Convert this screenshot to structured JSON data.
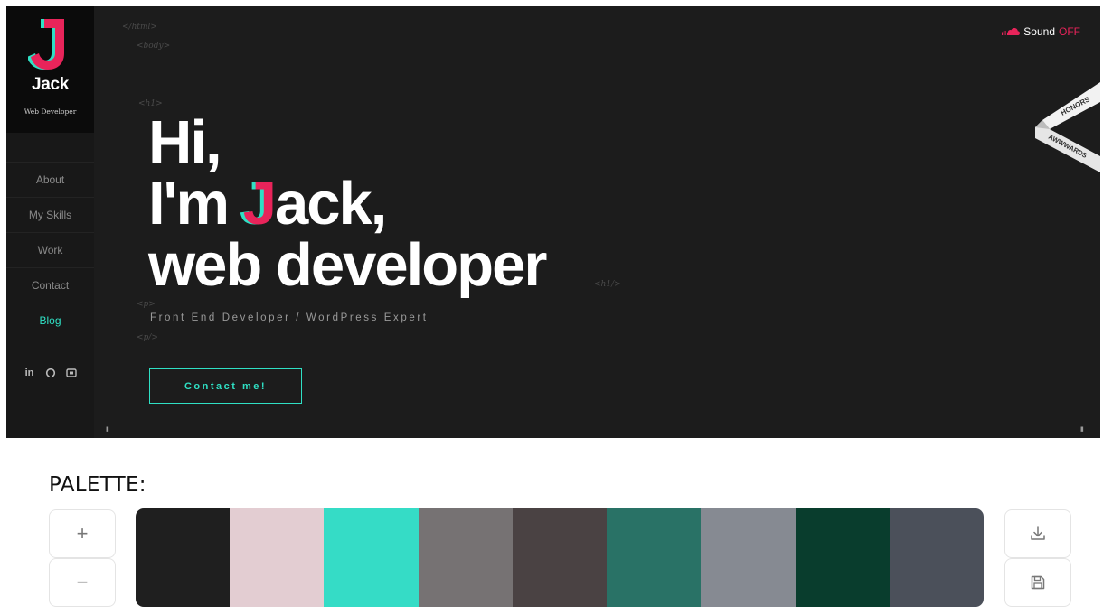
{
  "site": {
    "brand": {
      "logo_letter": "J",
      "name": "Jack",
      "role": "Web Developer"
    },
    "nav": [
      {
        "label": "About",
        "active": false
      },
      {
        "label": "My Skills",
        "active": false
      },
      {
        "label": "Work",
        "active": false
      },
      {
        "label": "Contact",
        "active": false
      },
      {
        "label": "Blog",
        "active": true
      }
    ],
    "socials": [
      {
        "icon": "linkedin-icon",
        "glyph": "in"
      },
      {
        "icon": "github-icon",
        "glyph": ""
      },
      {
        "icon": "youtube-icon",
        "glyph": ""
      }
    ],
    "tags": {
      "html_close": "</html>",
      "body_open": "<body>",
      "h1_open": "<h1>",
      "h1_close": "<h1/>",
      "p_open": "<p>",
      "p_close": "<p/>"
    },
    "sound": {
      "label": "Sound",
      "state": "OFF"
    },
    "hero": {
      "line1": "Hi,",
      "line2_prefix": "I'm ",
      "line2_accent": "J",
      "line2_suffix": "ack,",
      "line3": "web developer",
      "subtitle": "Front End Developer / WordPress Expert",
      "cta": "Contact me!"
    },
    "ribbon": {
      "top": "HONORS",
      "bottom": "AWWWARDS"
    },
    "colors": {
      "accent_teal": "#2fe0c4",
      "accent_pink": "#e8245a",
      "background": "#1c1c1c"
    }
  },
  "palette": {
    "title": "PALETTE:",
    "buttons": {
      "add": "+",
      "remove": "−"
    },
    "colors": [
      "#1f1f1f",
      "#e3cdd2",
      "#35dcc6",
      "#767273",
      "#4a4243",
      "#297266",
      "#868a92",
      "#093d2d",
      "#4b505a"
    ]
  }
}
